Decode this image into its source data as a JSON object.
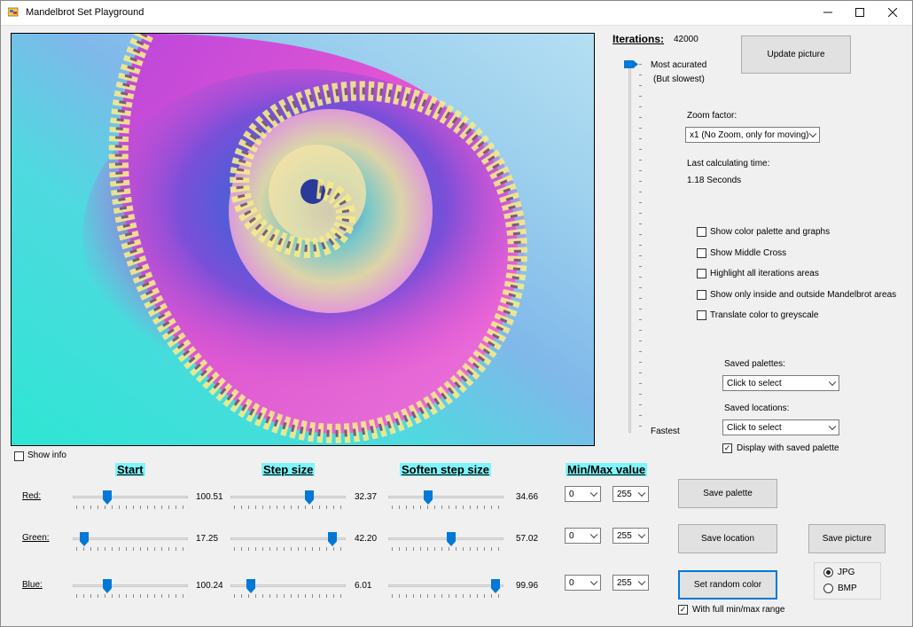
{
  "window": {
    "title": "Mandelbrot Set Playground",
    "minimize_icon": "minimize-icon",
    "maximize_icon": "maximize-icon",
    "close_icon": "close-icon"
  },
  "picture": {
    "alt": "Mandelbrot set render: spiral in magenta, blue and cyan tones"
  },
  "show_info": {
    "label": "Show info",
    "checked": false
  },
  "iterations": {
    "label": "Iterations:",
    "value": "42000",
    "top_label": "Most acurated",
    "top_sub_label": "(But slowest)",
    "bottom_label": "Fastest",
    "level": 1.0
  },
  "update_button": "Update picture",
  "zoom": {
    "label": "Zoom factor:",
    "selected": "x1 (No Zoom, only for moving)"
  },
  "calc_time": {
    "label": "Last calculating time:",
    "value": "1.18 Seconds"
  },
  "options": [
    {
      "label": "Show color palette and graphs",
      "checked": false
    },
    {
      "label": "Show Middle Cross",
      "checked": false
    },
    {
      "label": "Highlight all iterations areas",
      "checked": false
    },
    {
      "label": "Show only inside and outside Mandelbrot areas",
      "checked": false
    },
    {
      "label": "Translate color to greyscale",
      "checked": false
    }
  ],
  "saved_palettes": {
    "label": "Saved palettes:",
    "selected": "Click to select"
  },
  "saved_locations": {
    "label": "Saved locations:",
    "selected": "Click to select"
  },
  "display_saved_palette": {
    "label": "Display with saved palette",
    "checked": true
  },
  "headings": {
    "start": "Start",
    "step": "Step size",
    "soften": "Soften step size",
    "minmax": "Min/Max value"
  },
  "channels": [
    {
      "name": "Red:",
      "start": "100.51",
      "start_pos": 0.28,
      "step": "32.37",
      "step_pos": 0.7,
      "soften": "34.66",
      "soften_pos": 0.33,
      "min": "0",
      "max": "255"
    },
    {
      "name": "Green:",
      "start": "17.25",
      "start_pos": 0.07,
      "step": "42.20",
      "step_pos": 0.92,
      "soften": "57.02",
      "soften_pos": 0.55,
      "min": "0",
      "max": "255"
    },
    {
      "name": "Blue:",
      "start": "100.24",
      "start_pos": 0.28,
      "step": "6.01",
      "step_pos": 0.15,
      "soften": "99.96",
      "soften_pos": 0.97,
      "min": "0",
      "max": "255"
    }
  ],
  "buttons": {
    "save_palette": "Save  palette",
    "save_location": "Save location",
    "save_picture": "Save picture",
    "random_color": "Set random color"
  },
  "full_range": {
    "label": "With full min/max range",
    "checked": true
  },
  "format": {
    "jpg": "JPG",
    "bmp": "BMP",
    "selected": "JPG"
  },
  "colors": {
    "accent": "#0078d7",
    "heading_bg": "#7ff5fa"
  }
}
